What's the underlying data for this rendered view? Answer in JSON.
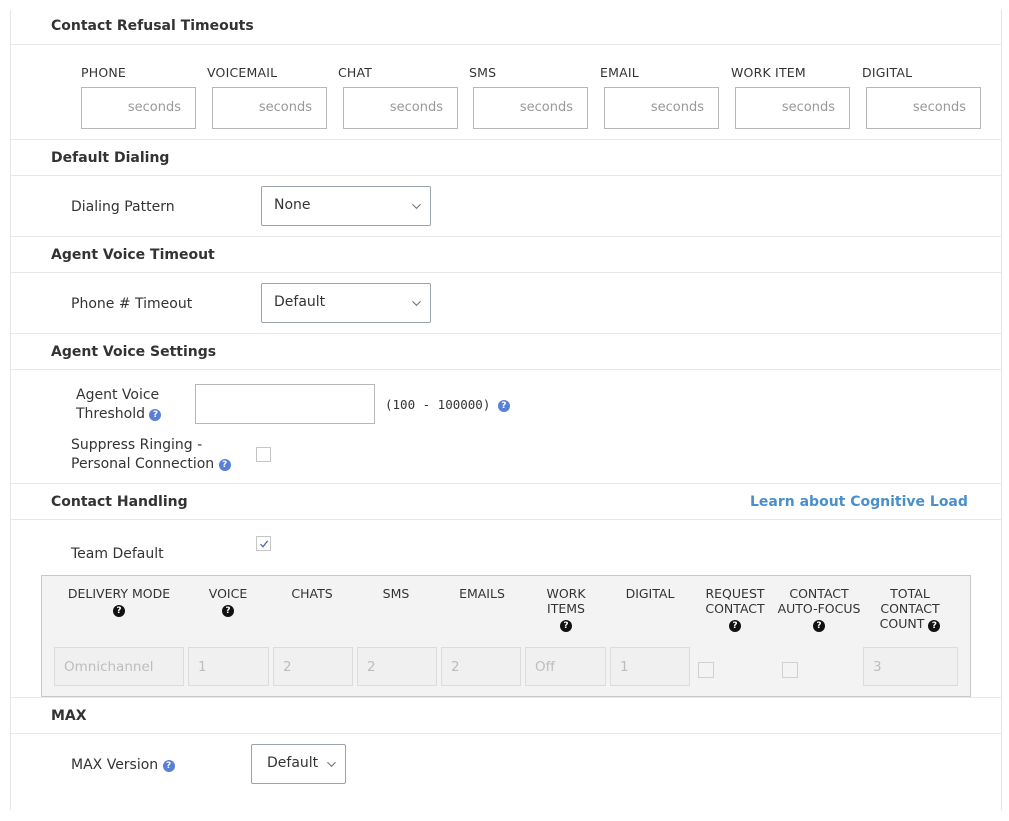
{
  "contact_refusal": {
    "title": "Contact Refusal Timeouts",
    "columns": [
      {
        "label": "PHONE",
        "placeholder": "seconds"
      },
      {
        "label": "VOICEMAIL",
        "placeholder": "seconds"
      },
      {
        "label": "CHAT",
        "placeholder": "seconds"
      },
      {
        "label": "SMS",
        "placeholder": "seconds"
      },
      {
        "label": "EMAIL",
        "placeholder": "seconds"
      },
      {
        "label": "WORK ITEM",
        "placeholder": "seconds"
      },
      {
        "label": "DIGITAL",
        "placeholder": "seconds"
      }
    ]
  },
  "default_dialing": {
    "title": "Default Dialing",
    "label": "Dialing Pattern",
    "value": "None"
  },
  "agent_voice_timeout": {
    "title": "Agent Voice Timeout",
    "label": "Phone # Timeout",
    "value": "Default"
  },
  "agent_voice_settings": {
    "title": "Agent Voice Settings",
    "threshold_label_1": "Agent Voice",
    "threshold_label_2": "Threshold",
    "threshold_value": "",
    "threshold_range": "(100 - 100000)",
    "suppress_label_1": "Suppress Ringing -",
    "suppress_label_2": "Personal Connection",
    "suppress_checked": false
  },
  "contact_handling": {
    "title": "Contact Handling",
    "learn_link": "Learn about Cognitive Load",
    "team_default_label": "Team Default",
    "team_default_checked": true,
    "headers": {
      "delivery_mode": "DELIVERY MODE",
      "voice": "VOICE",
      "chats": "CHATS",
      "sms": "SMS",
      "emails": "EMAILS",
      "work_items_1": "WORK",
      "work_items_2": "ITEMS",
      "digital": "DIGITAL",
      "request_contact_1": "REQUEST",
      "request_contact_2": "CONTACT",
      "contact_autofocus_1": "CONTACT",
      "contact_autofocus_2": "AUTO-FOCUS",
      "total_1": "TOTAL",
      "total_2": "CONTACT",
      "total_3": "COUNT"
    },
    "row": {
      "delivery_mode": "Omnichannel",
      "voice": "1",
      "chats": "2",
      "sms": "2",
      "emails": "2",
      "work_items": "Off",
      "digital": "1",
      "request_contact": false,
      "contact_autofocus": false,
      "total": "3"
    }
  },
  "max": {
    "title": "MAX",
    "label": "MAX Version",
    "value": "Default"
  },
  "icons": {
    "help": "?",
    "help_icon_color": "#5a7fd6",
    "link_color": "#4a8fcc"
  }
}
